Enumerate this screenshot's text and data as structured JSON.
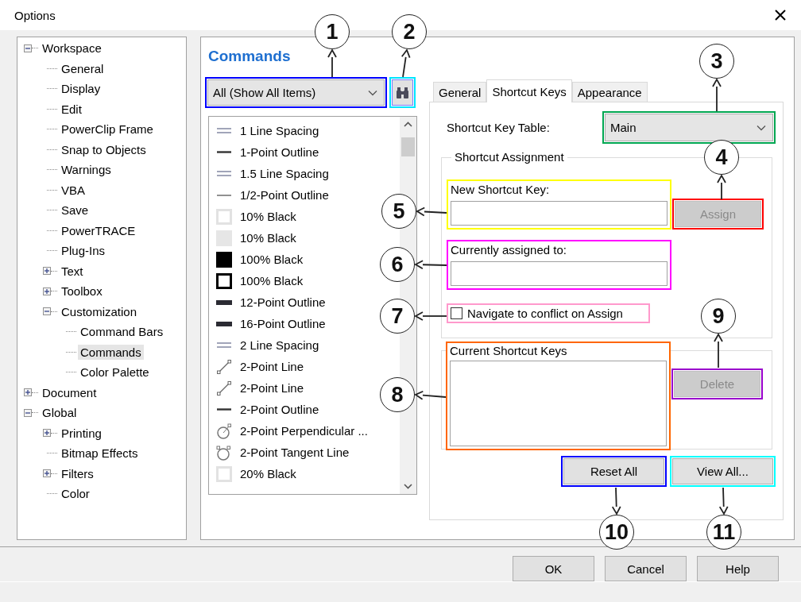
{
  "window": {
    "title": "Options"
  },
  "tree": [
    {
      "label": "Workspace",
      "selected": false,
      "expanded": true,
      "children": [
        {
          "label": "General",
          "selected": false
        },
        {
          "label": "Display",
          "selected": false
        },
        {
          "label": "Edit",
          "selected": false
        },
        {
          "label": "PowerClip Frame",
          "selected": false
        },
        {
          "label": "Snap to Objects",
          "selected": false
        },
        {
          "label": "Warnings",
          "selected": false
        },
        {
          "label": "VBA",
          "selected": false
        },
        {
          "label": "Save",
          "selected": false
        },
        {
          "label": "PowerTRACE",
          "selected": false
        },
        {
          "label": "Plug-Ins",
          "selected": false
        },
        {
          "label": "Text",
          "selected": false,
          "expanded": false
        },
        {
          "label": "Toolbox",
          "selected": false,
          "expanded": false
        },
        {
          "label": "Customization",
          "selected": false,
          "expanded": true,
          "children": [
            {
              "label": "Command Bars",
              "selected": false
            },
            {
              "label": "Commands",
              "selected": true
            },
            {
              "label": "Color Palette",
              "selected": false
            }
          ]
        }
      ]
    },
    {
      "label": "Document",
      "selected": false,
      "expanded": false
    },
    {
      "label": "Global",
      "selected": false,
      "expanded": true,
      "children": [
        {
          "label": "Printing",
          "selected": false,
          "expanded": false
        },
        {
          "label": "Bitmap Effects",
          "selected": false
        },
        {
          "label": "Filters",
          "selected": false,
          "expanded": false
        },
        {
          "label": "Color",
          "selected": false
        }
      ]
    }
  ],
  "commands": {
    "heading": "Commands",
    "filter": "All (Show All Items)",
    "items": [
      {
        "kind": "double-line",
        "label": "1 Line Spacing"
      },
      {
        "kind": "line-medium",
        "label": "1-Point Outline"
      },
      {
        "kind": "double-line",
        "label": "1.5 Line Spacing"
      },
      {
        "kind": "line-thin",
        "label": "1/2-Point Outline"
      },
      {
        "kind": "square-outline-light",
        "label": "10% Black"
      },
      {
        "kind": "square-light",
        "label": "10% Black"
      },
      {
        "kind": "square-black",
        "label": "100% Black"
      },
      {
        "kind": "square-outline-black",
        "label": "100% Black"
      },
      {
        "kind": "bar-thick",
        "label": "12-Point Outline"
      },
      {
        "kind": "bar-thick",
        "label": "16-Point Outline"
      },
      {
        "kind": "double-line",
        "label": "2 Line Spacing"
      },
      {
        "kind": "two-point-line",
        "label": "2-Point Line"
      },
      {
        "kind": "two-point-line",
        "label": "2-Point Line"
      },
      {
        "kind": "line-medium",
        "label": "2-Point Outline"
      },
      {
        "kind": "circle-handle",
        "label": "2-Point Perpendicular ..."
      },
      {
        "kind": "circle-handles",
        "label": "2-Point Tangent Line"
      },
      {
        "kind": "square-outline-light",
        "label": "20% Black"
      }
    ]
  },
  "tabs": [
    {
      "label": "General",
      "selected": false
    },
    {
      "label": "Shortcut Keys",
      "selected": true
    },
    {
      "label": "Appearance",
      "selected": false
    }
  ],
  "shortcut_keys": {
    "table_label": "Shortcut Key Table:",
    "table_value": "Main",
    "assignment_group": "Shortcut Assignment",
    "new_key_label": "New Shortcut Key:",
    "assign_button": {
      "label": "Assign",
      "disabled": true
    },
    "assigned_to_label": "Currently assigned to:",
    "navigate_checkbox": {
      "label": "Navigate to conflict on Assign",
      "checked": false
    },
    "current_keys_label": "Current Shortcut Keys",
    "delete_button": {
      "label": "Delete",
      "disabled": true
    },
    "reset_button": "Reset All",
    "view_button": "View All..."
  },
  "buttons": [
    "OK",
    "Cancel",
    "Help"
  ],
  "callouts": [
    {
      "number": "1",
      "color": "#0000ff"
    },
    {
      "number": "2",
      "color": "#00e5ff"
    },
    {
      "number": "3",
      "color": "#00a651"
    },
    {
      "number": "4",
      "color": "#ff0000"
    },
    {
      "number": "5",
      "color": "#ffff00"
    },
    {
      "number": "6",
      "color": "#ff00ff"
    },
    {
      "number": "7",
      "color": "#ff99cc"
    },
    {
      "number": "8",
      "color": "#ff6600"
    },
    {
      "number": "9",
      "color": "#9900cc"
    },
    {
      "number": "10",
      "color": "#0000ff"
    },
    {
      "number": "11",
      "color": "#00ffff"
    }
  ]
}
